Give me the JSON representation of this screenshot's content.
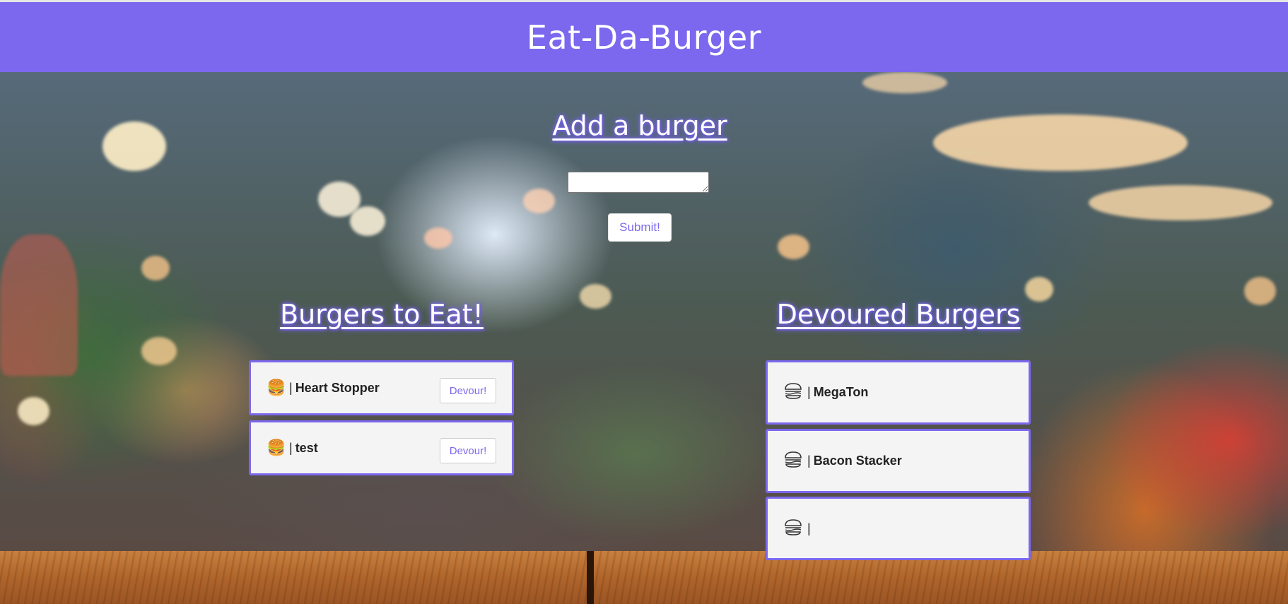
{
  "header": {
    "title": "Eat-Da-Burger"
  },
  "add_section": {
    "title": "Add a burger",
    "input_value": "",
    "submit_label": "Submit!"
  },
  "to_eat": {
    "title": "Burgers to Eat!",
    "items": [
      {
        "separator": "|",
        "name": "Heart Stopper",
        "button_label": "Devour!"
      },
      {
        "separator": "|",
        "name": "test",
        "button_label": "Devour!"
      }
    ]
  },
  "devoured": {
    "title": "Devoured Burgers",
    "items": [
      {
        "separator": "|",
        "name": "MegaTon"
      },
      {
        "separator": "|",
        "name": "Bacon Stacker"
      },
      {
        "separator": "|",
        "name": ""
      }
    ]
  },
  "colors": {
    "accent": "#7b68ee",
    "card_bg": "#f4f4f4"
  },
  "icons": {
    "to_eat": "burger-emoji-icon",
    "devoured": "burger-outline-icon"
  }
}
